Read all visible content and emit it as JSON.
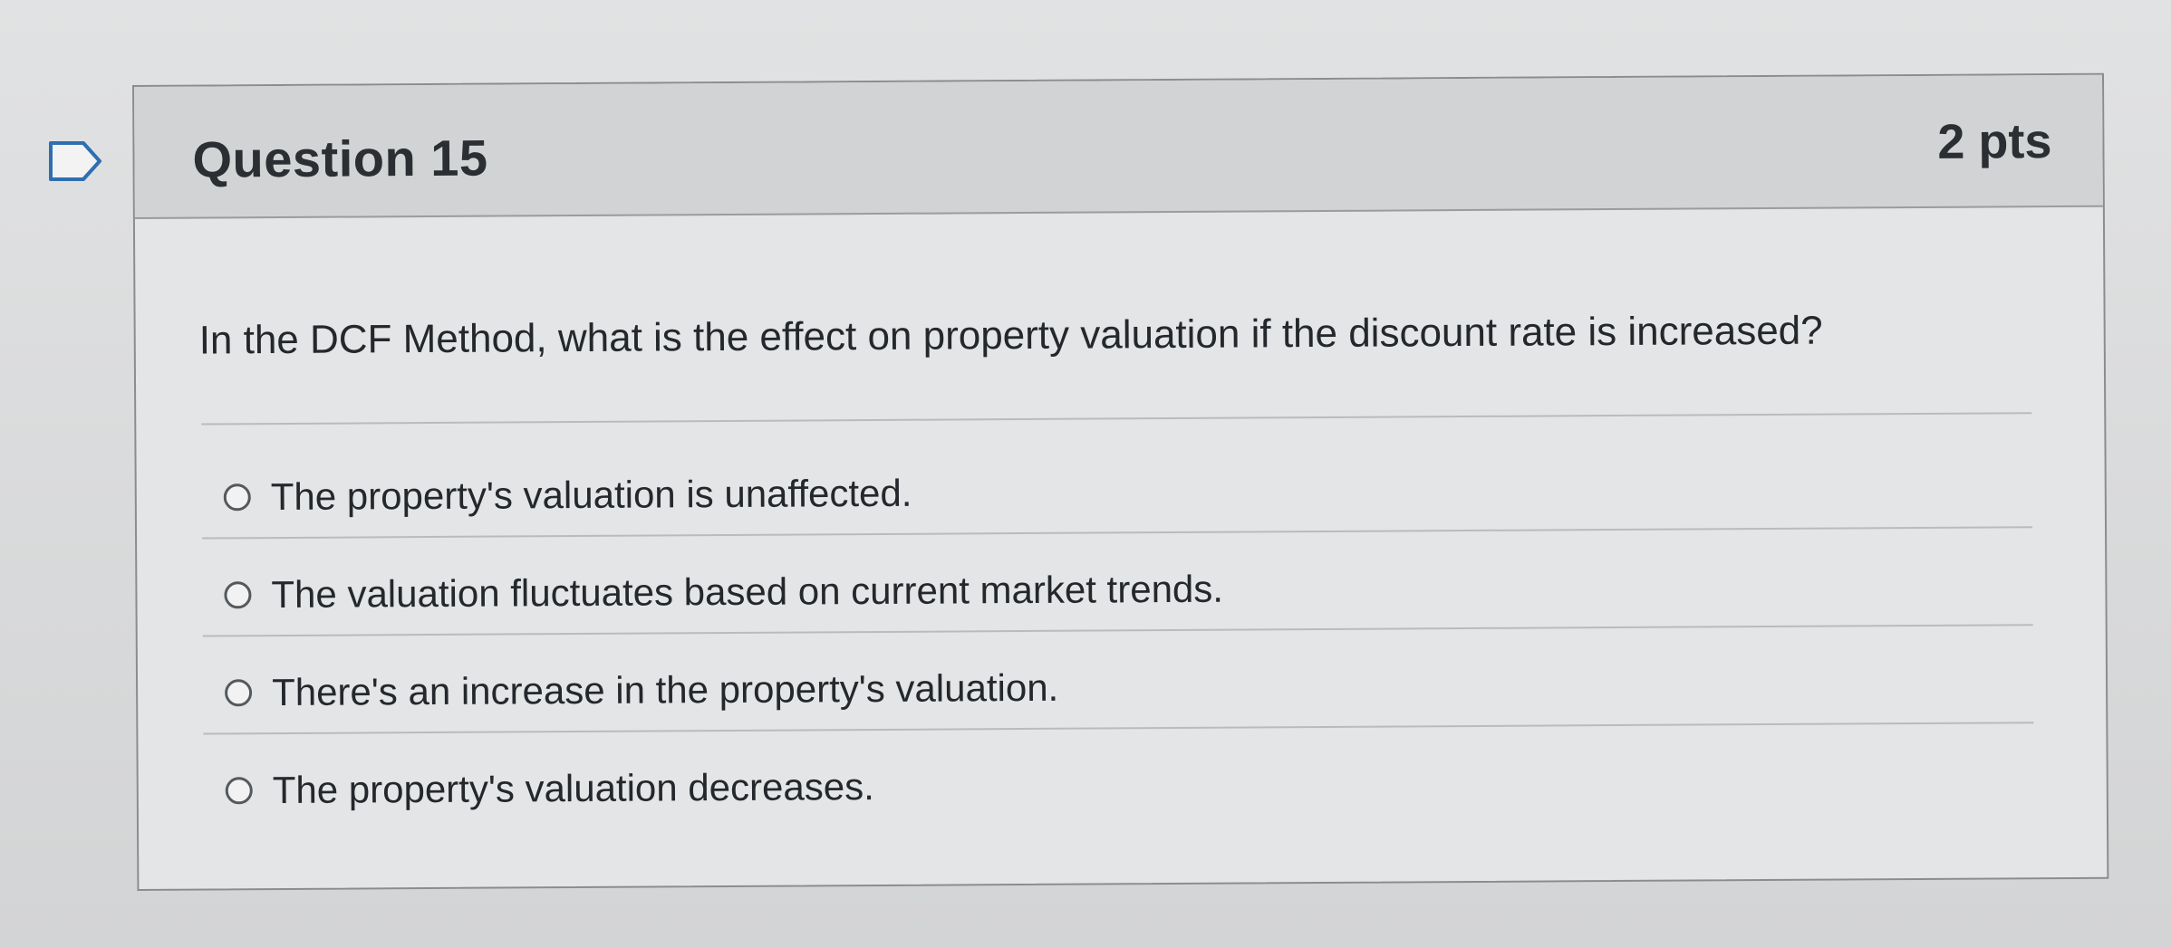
{
  "question": {
    "title": "Question 15",
    "points": "2 pts",
    "text": "In the DCF Method, what is the effect on property valuation if the discount rate is increased?",
    "flag_icon": "flag-outline-icon",
    "answers": [
      {
        "label": "The property's valuation is unaffected.",
        "selected": false
      },
      {
        "label": "The valuation fluctuates based on current market trends.",
        "selected": false
      },
      {
        "label": "There's an increase in the property's valuation.",
        "selected": false
      },
      {
        "label": "The property's valuation decreases.",
        "selected": false
      }
    ]
  },
  "colors": {
    "background": "#d8d9da",
    "header": "#d2d3d4",
    "text": "#24282c"
  }
}
